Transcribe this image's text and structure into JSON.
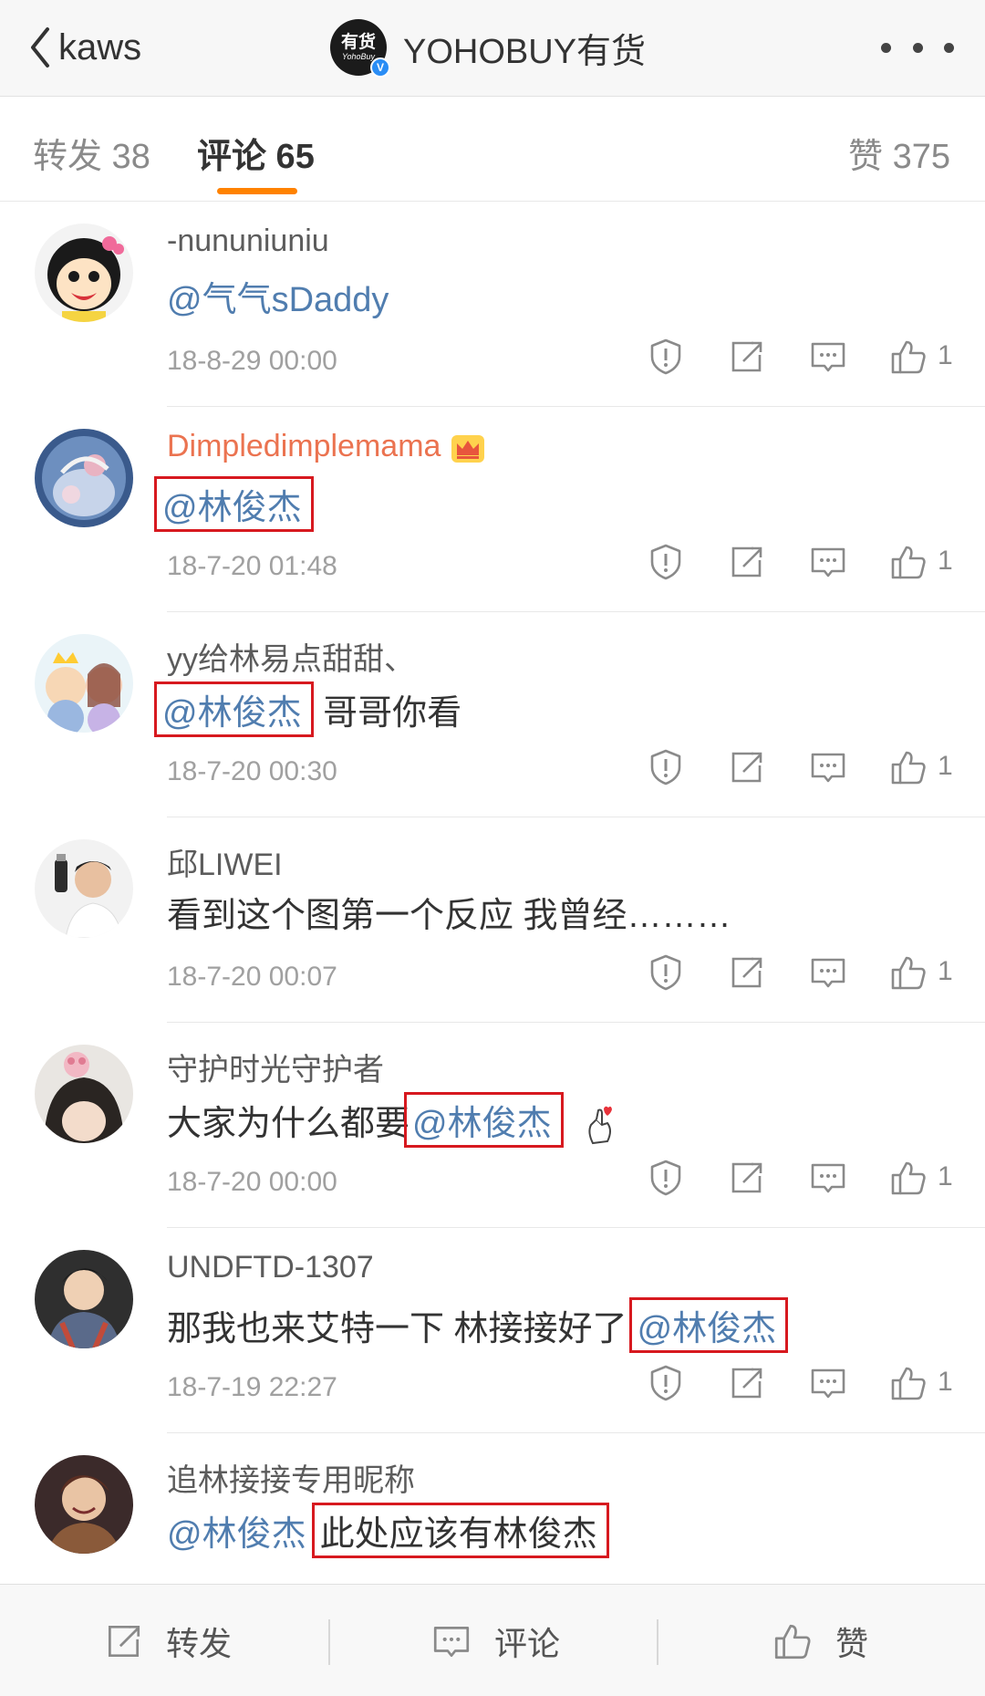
{
  "header": {
    "back_label": "kaws",
    "account_name": "YOHOBUY有货",
    "logo_text_top": "有货",
    "logo_text_bottom": "YohoBuy",
    "verified_mark": "V"
  },
  "tabs": [
    {
      "label": "转发 38",
      "active": false
    },
    {
      "label": "评论 65",
      "active": true
    },
    {
      "label": "赞 375",
      "active": false
    }
  ],
  "comments": [
    {
      "user": "-nununiuniu",
      "segments": [
        {
          "t": "@气气sDaddy",
          "mention": true
        }
      ],
      "date": "18-8-29 00:00",
      "likes": "1"
    },
    {
      "user": "Dimpledimplemama",
      "segments": [
        {
          "t": "@林俊杰",
          "mention": true
        }
      ],
      "date": "18-7-20 01:48",
      "likes": "1"
    },
    {
      "user": "yy给林易点甜甜、",
      "segments": [
        {
          "t": "@林俊杰",
          "mention": true
        },
        {
          "t": " 哥哥你看",
          "mention": false
        }
      ],
      "date": "18-7-20 00:30",
      "likes": "1"
    },
    {
      "user": "邱LIWEI",
      "segments": [
        {
          "t": "看到这个图第一个反应 我曾经………",
          "mention": false
        }
      ],
      "date": "18-7-20 00:07",
      "likes": "1"
    },
    {
      "user": "守护时光守护者",
      "segments": [
        {
          "t": "大家为什么都要",
          "mention": false
        },
        {
          "t": "@林俊杰",
          "mention": true
        }
      ],
      "date": "18-7-20 00:00",
      "likes": "1"
    },
    {
      "user": "UNDFTD-1307",
      "segments": [
        {
          "t": "那我也来艾特一下 林接接好了",
          "mention": false
        },
        {
          "t": "@林俊杰",
          "mention": true
        }
      ],
      "date": "18-7-19 22:27",
      "likes": "1"
    },
    {
      "user": "追林接接专用昵称",
      "segments": [
        {
          "t": "@林俊杰",
          "mention": true
        },
        {
          "t": "此处应该有林俊杰",
          "mention": false
        }
      ],
      "date": "",
      "likes": ""
    }
  ],
  "bottom_bar": {
    "repost_label": "转发",
    "comment_label": "评论",
    "like_label": "赞"
  },
  "colors": {
    "accent": "#ff8200",
    "mention": "#507daf",
    "vip_name": "#eb7350",
    "highlight_box": "#d7191f"
  },
  "icons": [
    "chevron-left-icon",
    "more-dots-icon",
    "report-icon",
    "share-icon",
    "reply-icon",
    "thumbs-up-icon",
    "crown-icon",
    "heart-hand-icon"
  ]
}
